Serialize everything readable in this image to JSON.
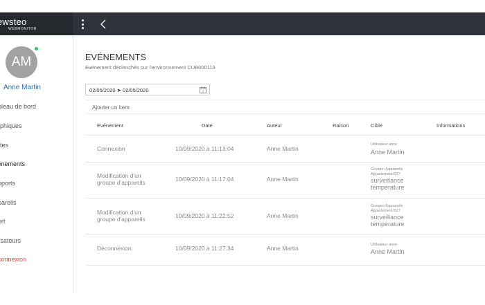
{
  "brand": {
    "name": "ewsteo",
    "sub": "WEBMONITOR"
  },
  "user": {
    "initials": "AM",
    "name": "Anne Martin"
  },
  "nav": [
    {
      "label": "ableau de bord"
    },
    {
      "label": "raphiques"
    },
    {
      "label": "ertes"
    },
    {
      "label": "vénements"
    },
    {
      "label": "apports"
    },
    {
      "label": "ppareils"
    },
    {
      "label": "port"
    },
    {
      "label": "tilisateurs"
    },
    {
      "label": "éconnexion"
    }
  ],
  "page": {
    "title": "EVÉNEMENTS",
    "subtitle": "Evénement déclenchés sur l'environnement CUB000113"
  },
  "date_range": {
    "value": "02/05/2020 ➤ 02/05/2020"
  },
  "add_item": {
    "label": "Ajouter un item"
  },
  "table": {
    "headers": {
      "evenement": "Evénement",
      "date": "Date",
      "auteur": "Auteur",
      "raison": "Raison",
      "cible": "Cible",
      "informations": "Informations"
    },
    "rows": [
      {
        "evenement_l1": "Connexion",
        "evenement_l2": "",
        "date": "10/09/2020 à 11:13:04",
        "auteur": "Anne Martin",
        "cible_s1": "Utilisateur anne",
        "cible_s2": "",
        "cible_b1": "Anne Martin",
        "cible_b2": ""
      },
      {
        "evenement_l1": "Modification d'un",
        "evenement_l2": "groupe d'appareils",
        "date": "10/09/2020 à 11:17:04",
        "auteur": "Anne Martin",
        "cible_s1": "Groupe d'appareils",
        "cible_s2": "Appartement B27",
        "cible_b1": "surveillance",
        "cible_b2": "température"
      },
      {
        "evenement_l1": "Modification d'un",
        "evenement_l2": "groupe d'appareils",
        "date": "10/09/2020 à 11:22:52",
        "auteur": "Anne Martin",
        "cible_s1": "Groupe d'appareils",
        "cible_s2": "Appartement B27",
        "cible_b1": "surveillance",
        "cible_b2": "température"
      },
      {
        "evenement_l1": "Déconnexion",
        "evenement_l2": "",
        "date": "10/09/2020 à 11:27:34",
        "auteur": "Anne Martin",
        "cible_s1": "Utilisateur anne",
        "cible_s2": "",
        "cible_b1": "Anne Martin",
        "cible_b2": ""
      }
    ]
  }
}
